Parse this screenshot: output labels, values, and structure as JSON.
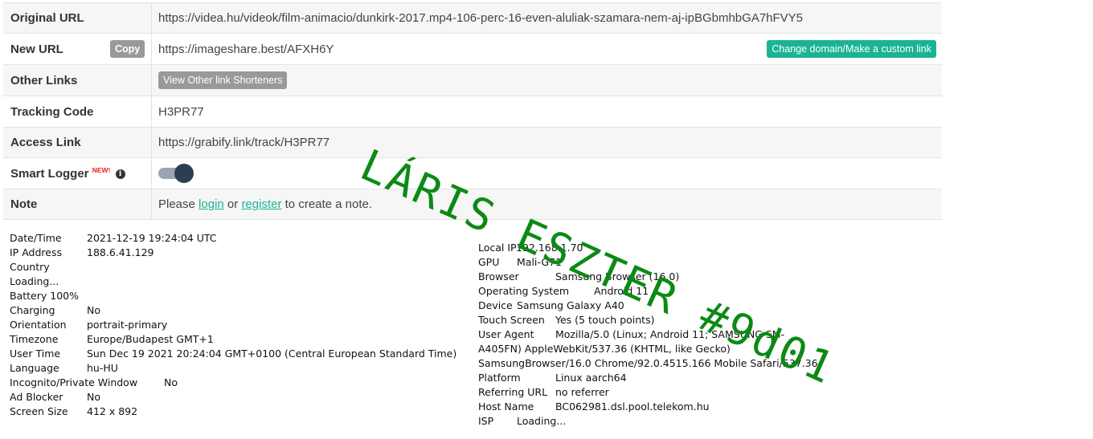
{
  "table": {
    "original_url": {
      "label": "Original URL",
      "value": "https://videa.hu/videok/film-animacio/dunkirk-2017.mp4-106-perc-16-even-aluliak-szamara-nem-aj-ipBGbmhbGA7hFVY5"
    },
    "new_url": {
      "label": "New URL",
      "copy_label": "Copy",
      "value": "https://imageshare.best/AFXH6Y",
      "change_label": "Change domain/Make a custom link"
    },
    "other_links": {
      "label": "Other Links",
      "button_label": "View Other link Shorteners"
    },
    "tracking_code": {
      "label": "Tracking Code",
      "value": "H3PR77"
    },
    "access_link": {
      "label": "Access Link",
      "value": "https://grabify.link/track/H3PR77"
    },
    "smart_logger": {
      "label": "Smart Logger",
      "badge": "NEW!",
      "info_icon": "info-circle-icon",
      "enabled": true
    },
    "note": {
      "label": "Note",
      "prefix": "Please",
      "login": "login",
      "or": "or",
      "register": "register",
      "suffix": "to create a note."
    }
  },
  "left_info": [
    {
      "k": "Date/Time",
      "v": "2021-12-19 19:24:04 UTC"
    },
    {
      "k": "IP Address",
      "v": "188.6.41.129"
    },
    {
      "k": "Country",
      "v": ""
    },
    {
      "k": "Loading...",
      "v": ""
    },
    {
      "k": "Battery 100%",
      "v": ""
    },
    {
      "k": "Charging",
      "v": "No"
    },
    {
      "k": "Orientation",
      "v": "portrait-primary"
    },
    {
      "k": "Timezone",
      "v": "Europe/Budapest GMT+1"
    },
    {
      "k": "User Time",
      "v": "Sun Dec 19 2021 20:24:04 GMT+0100 (Central European Standard Time)"
    },
    {
      "k": "Language",
      "v": "hu-HU"
    },
    {
      "k": "Incognito/Private Window",
      "v": "No"
    },
    {
      "k": "Ad Blocker",
      "v": "No"
    },
    {
      "k": "Screen Size",
      "v": "412 x 892"
    }
  ],
  "right_info": [
    {
      "k": "Local IP",
      "v": "192.168.1.70"
    },
    {
      "k": "GPU",
      "v": "Mali-G71"
    },
    {
      "k": "Browser",
      "v": "Samsung Browser (16.0)"
    },
    {
      "k": "Operating System",
      "v": "Android 11"
    },
    {
      "k": "Device",
      "v": "Samsung Galaxy A40"
    },
    {
      "k": "Touch Screen",
      "v": "Yes (5 touch points)"
    },
    {
      "k": "User Agent",
      "v": "Mozilla/5.0 (Linux; Android 11; SAMSUNG SM-"
    },
    {
      "k": "A405FN) AppleWebKit/537.36 (KHTML, like Gecko)",
      "v": ""
    },
    {
      "k": "SamsungBrowser/16.0 Chrome/92.0.4515.166 Mobile Safari/537.36",
      "v": ""
    },
    {
      "k": "Platform",
      "v": "Linux aarch64"
    },
    {
      "k": "Referring URL",
      "v": "no referrer"
    },
    {
      "k": "Host Name",
      "v": "BC062981.dsl.pool.telekom.hu"
    },
    {
      "k": "ISP",
      "v": "Loading..."
    }
  ],
  "watermark": "LÁRIS ESZTER #9d01",
  "colors": {
    "accent": "#1ab394",
    "gray_button": "#999999",
    "watermark": "#0b8a14"
  }
}
